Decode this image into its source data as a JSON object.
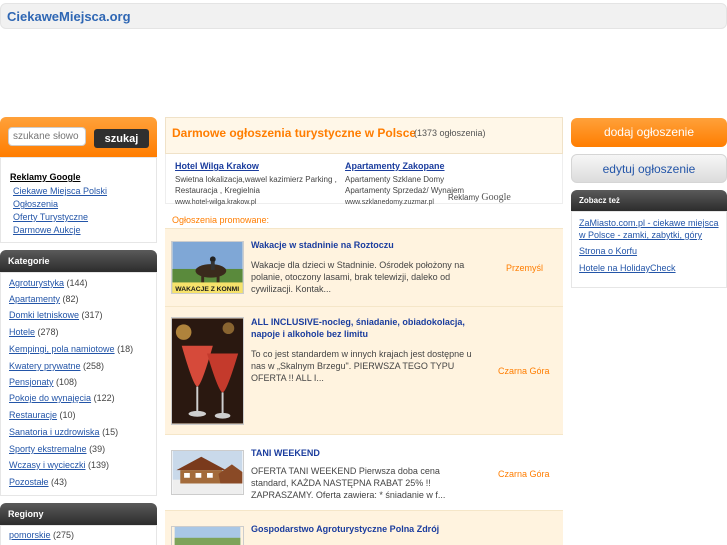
{
  "site": {
    "logo": "CiekaweMiejsca.org"
  },
  "search": {
    "placeholder": "szukane słowo",
    "button": "szukaj"
  },
  "left_links": {
    "heading": "Reklamy Google",
    "items": [
      "Ciekawe Miejsca Polski",
      "Ogłoszenia",
      "Oferty Turystyczne",
      "Darmowe Aukcje"
    ]
  },
  "categories": {
    "heading": "Kategorie",
    "items": [
      {
        "name": "Agroturystyka",
        "count": "(144)"
      },
      {
        "name": "Apartamenty",
        "count": "(82)"
      },
      {
        "name": "Domki letniskowe",
        "count": "(317)"
      },
      {
        "name": "Hotele",
        "count": "(278)"
      },
      {
        "name": "Kempingi, pola namiotowe",
        "count": "(18)"
      },
      {
        "name": "Kwatery prywatne",
        "count": "(258)"
      },
      {
        "name": "Pensjonaty",
        "count": "(108)"
      },
      {
        "name": "Pokoje do wynajęcia",
        "count": "(122)"
      },
      {
        "name": "Restauracje",
        "count": "(10)"
      },
      {
        "name": "Sanatoria i uzdrowiska",
        "count": "(15)"
      },
      {
        "name": "Sporty ekstremalne",
        "count": "(39)"
      },
      {
        "name": "Wczasy i wycieczki",
        "count": "(139)"
      },
      {
        "name": "Pozostałe",
        "count": "(43)"
      }
    ]
  },
  "regions": {
    "heading": "Regiony",
    "items": [
      {
        "name": "pomorskie",
        "count": "(275)"
      }
    ]
  },
  "center": {
    "title": "Darmowe ogłoszenia turystyczne w Polsce",
    "count": "(1373 ogłoszenia)",
    "ads": [
      {
        "title": "Hotel Wilga Krakow",
        "text": "Swietna lokalizacja,wawel kazimierz Parking , Restauracja , Kregielnia",
        "url": "www.hotel-wilga.krakow.pl"
      },
      {
        "title": "Apartamenty Zakopane",
        "text": "Apartamenty Szklane Domy Apartamenty Sprzedaż/ Wynajem",
        "url": "www.szklanedomy.zuzmar.pl"
      }
    ],
    "google_label": "Reklamy",
    "google_brand": "Google",
    "promo_label": "Ogłoszenia promowane:",
    "listings": [
      {
        "title": "Wakacje w stadninie na Roztoczu",
        "desc": "Wakacje dla dzieci w Stadninie. Ośrodek położony na polanie, otoczony lasami, brak telewizji, daleko od cywilizacji. Kontak...",
        "location": "Przemyśl",
        "thumb_text": "WAKACJE Z KONMI"
      },
      {
        "title": "ALL INCLUSIVE-nocleg, śniadanie, obiadokolacja, napoje i alkohole bez limitu",
        "desc": "To co jest standardem w innych krajach jest dostępne u nas w „Skalnym Brzegu\". PIERWSZA TEGO TYPU OFERTA !! ALL I...",
        "location": "Czarna Góra"
      },
      {
        "title": "TANI WEEKEND",
        "desc": "OFERTA TANI WEEKEND Pierwsza doba cena standard, KAŻDA NASTĘPNA RABAT 25% !! ZAPRASZAMY. Oferta zawiera: * śniadanie w f...",
        "location": "Czarna Góra"
      },
      {
        "title": "Gospodarstwo Agroturystyczne Polna Zdrój",
        "desc": "",
        "location": ""
      }
    ]
  },
  "right": {
    "add_button": "dodaj ogłoszenie",
    "edit_button": "edytuj ogłoszenie",
    "see_also_heading": "Zobacz też",
    "see_also": [
      "ZaMiasto.com.pl - ciekawe miejsca w Polsce - zamki, zabytki, góry",
      "Strona o Korfu",
      "Hotele na HolidayCheck"
    ]
  }
}
